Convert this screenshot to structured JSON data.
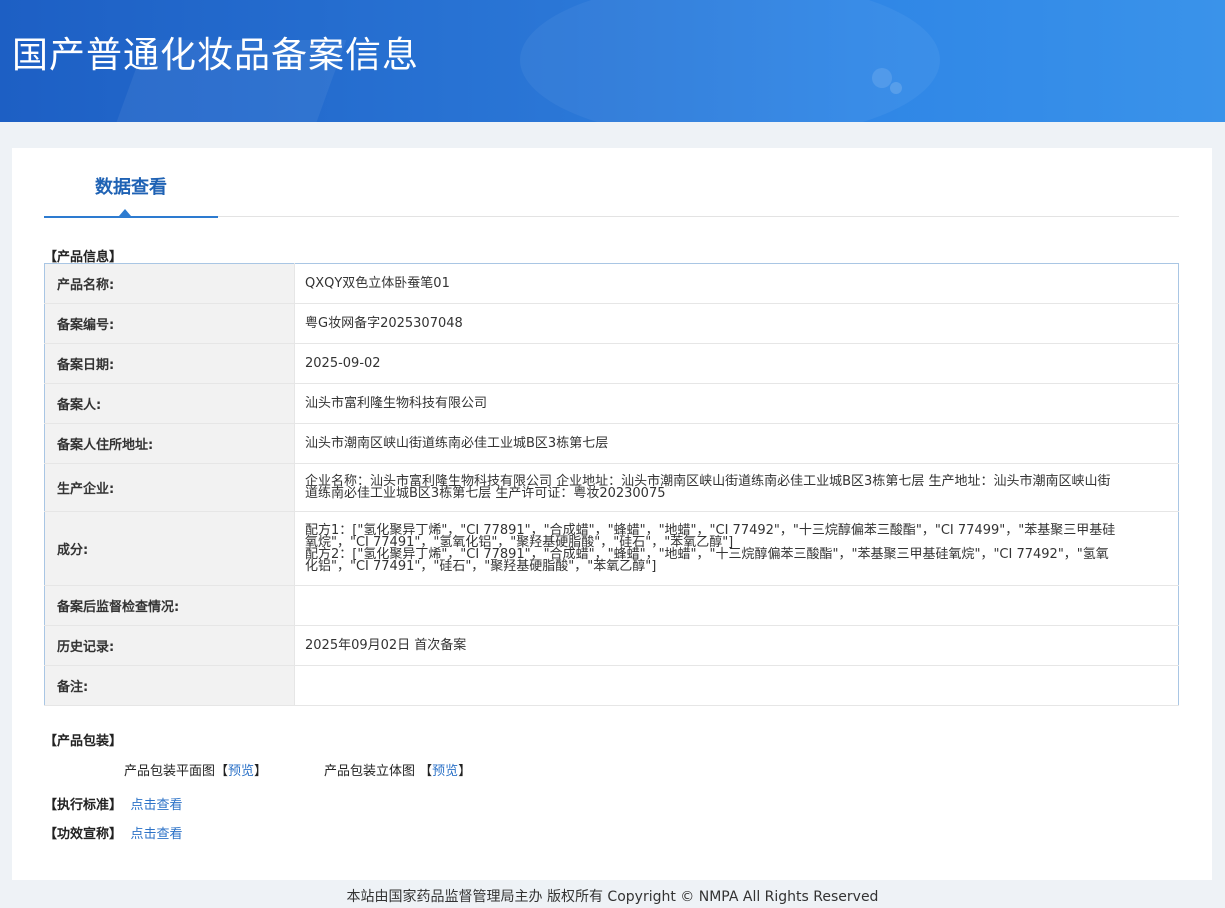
{
  "header": {
    "title": "国产普通化妆品备案信息"
  },
  "tabs": [
    {
      "label": "数据查看",
      "active": true
    }
  ],
  "product_info": {
    "section_label": "【产品信息】",
    "rows": [
      {
        "label": "产品名称:",
        "value": "QXQY双色立体卧蚕笔01"
      },
      {
        "label": "备案编号:",
        "value": "粤G妆网备字2025307048"
      },
      {
        "label": "备案日期:",
        "value": "2025-09-02"
      },
      {
        "label": "备案人:",
        "value": "汕头市富利隆生物科技有限公司"
      },
      {
        "label": "备案人住所地址:",
        "value": "汕头市潮南区峡山街道练南必佳工业城B区3栋第七层"
      },
      {
        "label": "生产企业:",
        "value": "企业名称：汕头市富利隆生物科技有限公司 企业地址：汕头市潮南区峡山街道练南必佳工业城B区3栋第七层 生产地址：汕头市潮南区峡山街道练南必佳工业城B区3栋第七层 生产许可证：粤妆20230075"
      },
      {
        "label": "成分:",
        "value": "配方1：[\"氢化聚异丁烯\"，\"CI 77891\"，\"合成蜡\"，\"蜂蜡\"，\"地蜡\"，\"CI 77492\"，\"十三烷醇偏苯三酸酯\"，\"CI 77499\"，\"苯基聚三甲基硅氧烷\"，\"CI 77491\"，\"氢氧化铝\"，\"聚羟基硬脂酸\"，\"硅石\"，\"苯氧乙醇\"]",
        "value2": "配方2：[\"氢化聚异丁烯\"，\"CI 77891\"，\"合成蜡\"，\"蜂蜡\"，\"地蜡\"，\"十三烷醇偏苯三酸酯\"，\"苯基聚三甲基硅氧烷\"，\"CI 77492\"，\"氢氧化铝\"，\"CI 77491\"，\"硅石\"，\"聚羟基硬脂酸\"，\"苯氧乙醇\"]"
      },
      {
        "label": "备案后监督检查情况:",
        "value": ""
      },
      {
        "label": "历史记录:",
        "value": "2025年09月02日 首次备案"
      },
      {
        "label": "备注:",
        "value": ""
      }
    ]
  },
  "packaging": {
    "section_label": "【产品包装】",
    "flat_label": "产品包装平面图",
    "solid_label": "产品包装立体图",
    "bracket_open": "【",
    "bracket_close": "】",
    "preview_label": "预览"
  },
  "standard": {
    "section_label": "【执行标准】",
    "link_label": "点击查看"
  },
  "efficacy": {
    "section_label": "【功效宣称】",
    "link_label": "点击查看"
  },
  "footer": {
    "text": "本站由国家药品监督管理局主办 版权所有 Copyright © NMPA All Rights Reserved"
  },
  "colors": {
    "banner": "#2a76d6",
    "accent": "#1f62b4",
    "link": "#2c72c7"
  }
}
